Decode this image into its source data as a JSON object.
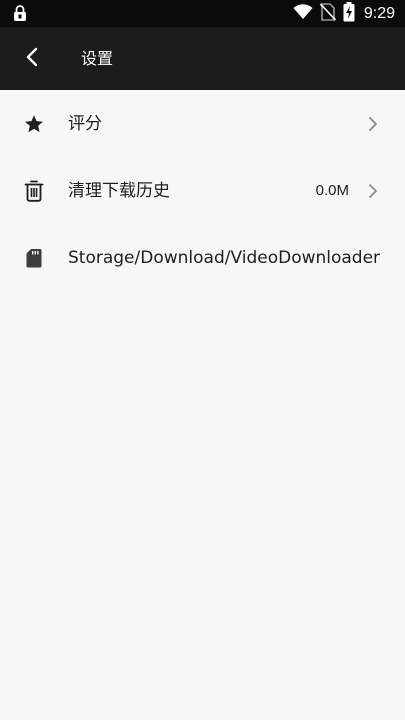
{
  "status_bar": {
    "time": "9:29",
    "icons": [
      "lock-icon",
      "wifi-icon",
      "no-sim-icon",
      "battery-charging-icon"
    ]
  },
  "app_bar": {
    "title": "设置",
    "back_icon": "back-arrow-icon"
  },
  "settings": {
    "items": [
      {
        "icon": "star-icon",
        "label": "评分",
        "value": "",
        "has_chevron": true
      },
      {
        "icon": "trash-icon",
        "label": "清理下载历史",
        "value": "0.0M",
        "has_chevron": true
      },
      {
        "icon": "sd-card-icon",
        "label": "Storage/Download/VideoDownloader",
        "value": "",
        "has_chevron": false
      }
    ]
  },
  "colors": {
    "status_bar_bg": "#0b0b0b",
    "app_bar_bg": "#1c1c1c",
    "page_bg": "#f7f7f7",
    "text_primary": "#1e1e1e",
    "chevron": "#8a8a8a"
  }
}
